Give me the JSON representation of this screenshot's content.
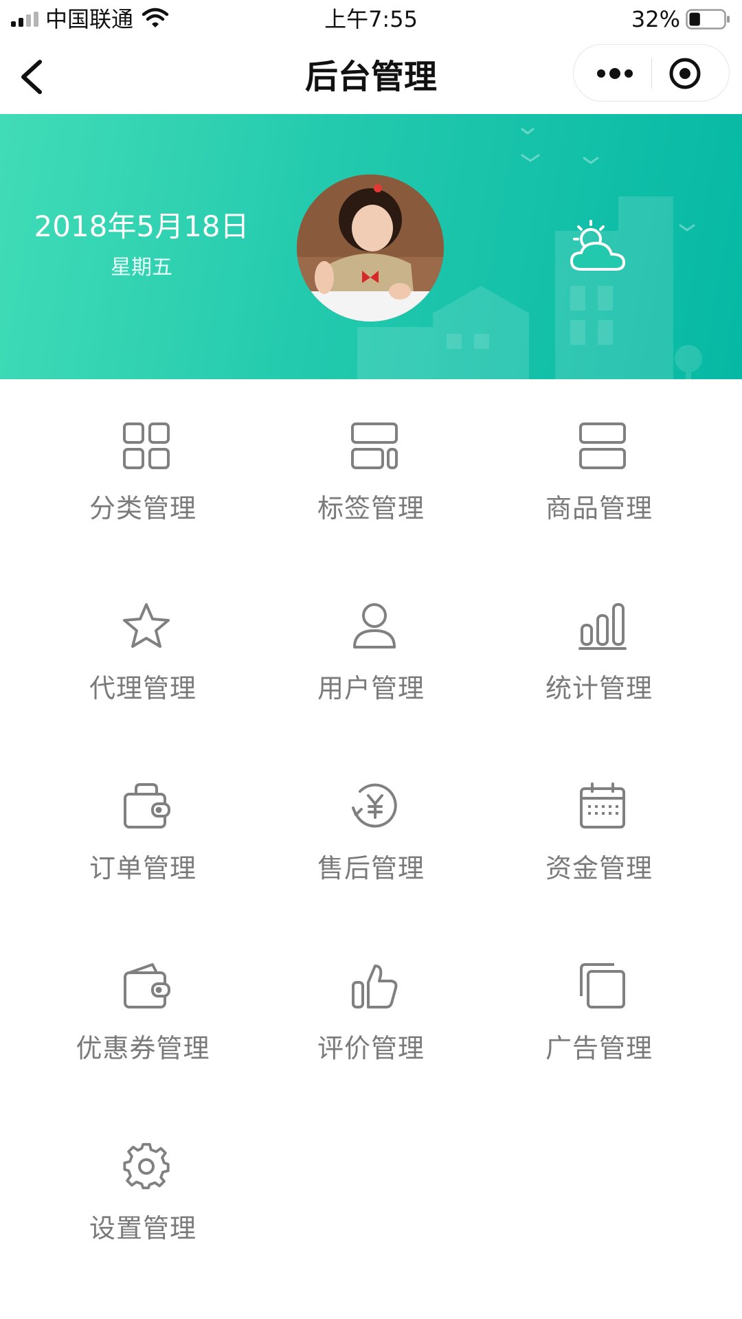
{
  "status_bar": {
    "carrier": "中国联通",
    "time": "上午7:55",
    "battery_percent": "32%",
    "battery_level": 0.32
  },
  "nav": {
    "title": "后台管理",
    "back_icon": "chevron-left-icon",
    "more_icon": "more-dots-icon",
    "close_icon": "target-close-icon"
  },
  "banner": {
    "date": "2018年5月18日",
    "weekday": "星期五",
    "weather_icon": "partly-cloudy-icon",
    "gradient": [
      "#41dcb7",
      "#06b8a4"
    ]
  },
  "menu": [
    {
      "label": "分类管理",
      "icon": "grid-icon"
    },
    {
      "label": "标签管理",
      "icon": "tag-layout-icon"
    },
    {
      "label": "商品管理",
      "icon": "product-layout-icon"
    },
    {
      "label": "代理管理",
      "icon": "star-icon"
    },
    {
      "label": "用户管理",
      "icon": "user-icon"
    },
    {
      "label": "统计管理",
      "icon": "bar-chart-icon"
    },
    {
      "label": "订单管理",
      "icon": "bag-icon"
    },
    {
      "label": "售后管理",
      "icon": "yen-refresh-icon"
    },
    {
      "label": "资金管理",
      "icon": "calendar-icon"
    },
    {
      "label": "优惠券管理",
      "icon": "wallet-icon"
    },
    {
      "label": "评价管理",
      "icon": "thumbs-up-icon"
    },
    {
      "label": "广告管理",
      "icon": "copy-icon"
    },
    {
      "label": "设置管理",
      "icon": "gear-icon"
    }
  ],
  "colors": {
    "icon_gray": "#808080",
    "label_gray": "#7a7a7a",
    "banner_accent": "#22c9ad"
  }
}
